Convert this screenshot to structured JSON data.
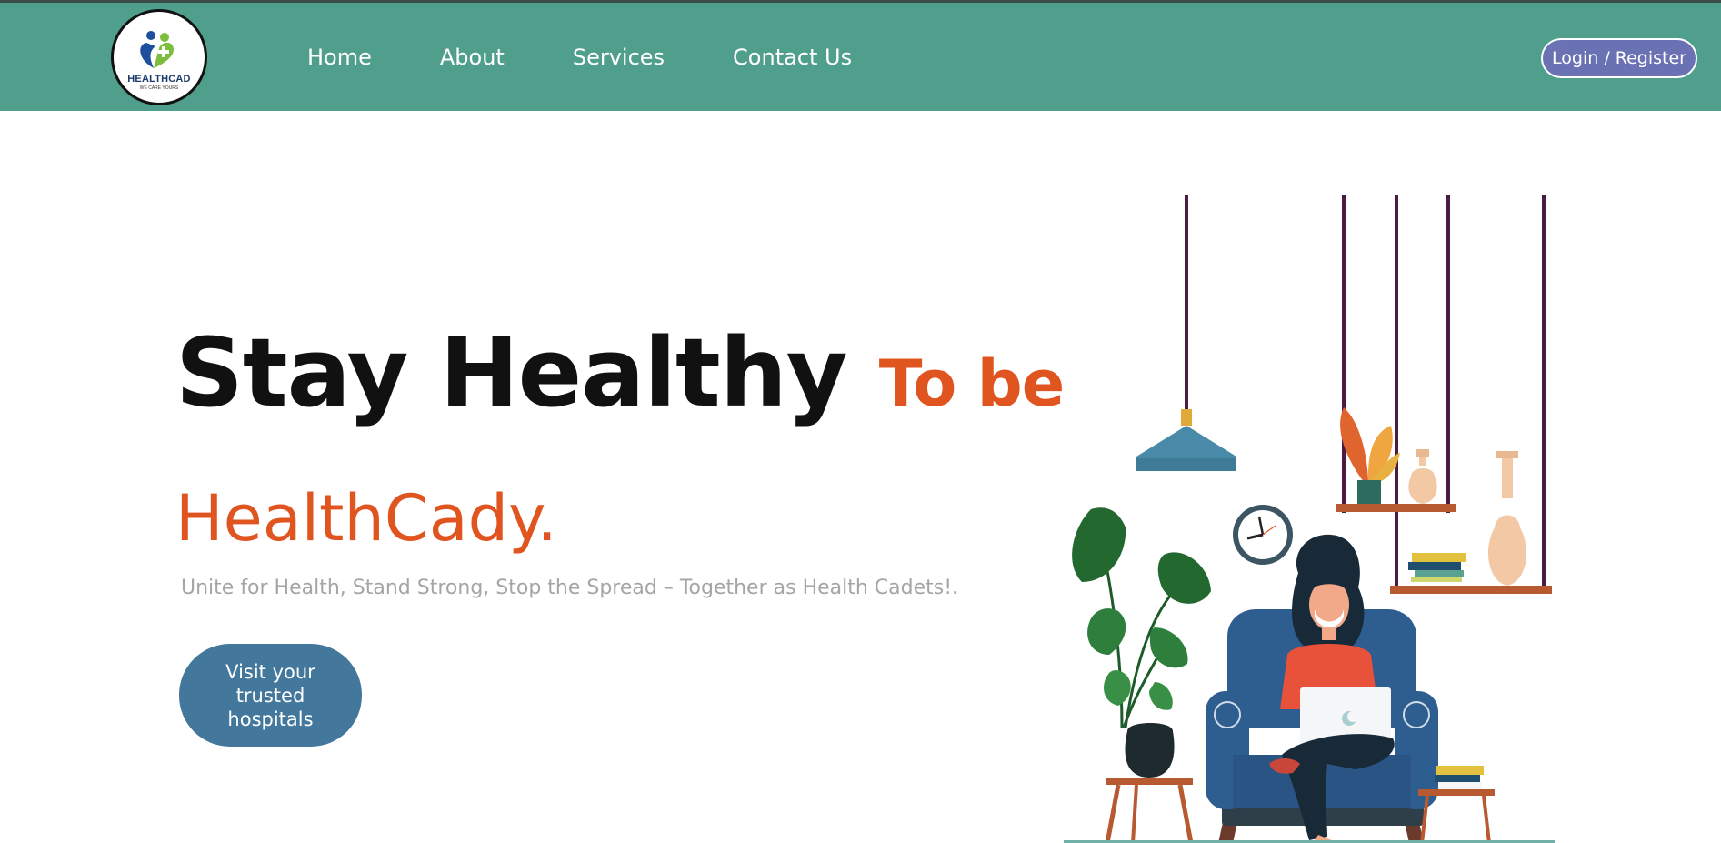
{
  "header": {
    "logo": {
      "brand": "HEALTHCAD",
      "tagline": "WE CARE YOURS"
    },
    "nav": [
      {
        "label": "Home"
      },
      {
        "label": "About"
      },
      {
        "label": "Services"
      },
      {
        "label": "Contact Us"
      }
    ],
    "login_label": "Login / Register"
  },
  "hero": {
    "title_main": "Stay Healthy",
    "title_accent": "To be",
    "title_line2": "HealthCady.",
    "tagline": "Unite for Health, Stand Strong, Stop the Spread – Together as Health Cadets!.",
    "cta_label": "Visit your trusted hospitals"
  },
  "colors": {
    "nav_bg": "#509e8c",
    "accent": "#e05420",
    "login_bg": "#6a72b4",
    "cta_bg": "#43779b"
  },
  "illustration": {
    "icons": [
      "pendant-lamp-icon",
      "wall-clock-icon",
      "monstera-plant-icon",
      "armchair-icon",
      "woman-with-laptop-icon",
      "hanging-shelf-icon",
      "vase-icon",
      "book-stack-icon",
      "side-table-icon"
    ]
  }
}
